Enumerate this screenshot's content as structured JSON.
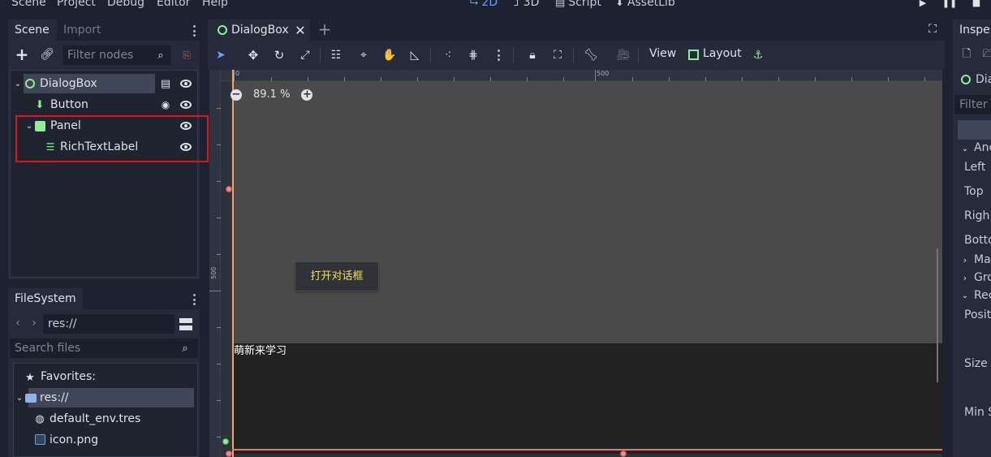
{
  "menu": {
    "items": [
      "Scene",
      "Project",
      "Debug",
      "Editor",
      "Help"
    ],
    "workspaces": [
      {
        "label": "2D",
        "icon": "2d-icon",
        "active": true
      },
      {
        "label": "3D",
        "icon": "3d-icon",
        "active": false
      },
      {
        "label": "Script",
        "icon": "script-icon",
        "active": false
      },
      {
        "label": "AssetLib",
        "icon": "assetlib-icon",
        "active": false
      }
    ]
  },
  "scene_dock": {
    "tabs": [
      "Scene",
      "Import"
    ],
    "filter_placeholder": "Filter nodes",
    "nodes": [
      {
        "label": "DialogBox",
        "icon": "control-node-icon",
        "selected": true
      },
      {
        "label": "Button",
        "icon": "button-node-icon"
      },
      {
        "label": "Panel",
        "icon": "panel-node-icon"
      },
      {
        "label": "RichTextLabel",
        "icon": "richtextlabel-node-icon"
      }
    ]
  },
  "filesystem": {
    "title": "FileSystem",
    "path": "res://",
    "search_placeholder": "Search files",
    "items": [
      "Favorites:",
      "res://",
      "default_env.tres",
      "icon.png"
    ]
  },
  "editor": {
    "tab_label": "DialogBox",
    "toolbar": {
      "view": "View",
      "layout": "Layout"
    },
    "zoom_label": "89.1 %",
    "ruler_top_labels": [
      "0",
      "500"
    ],
    "ruler_left_labels": [
      "500"
    ]
  },
  "game": {
    "button_text": "打开对话框",
    "label_text": "萌新来学习"
  },
  "inspector": {
    "tab_label": "Inspe",
    "node_label": "Dia",
    "filter_placeholder": "Filter",
    "sections": [
      "Anc",
      "Ma",
      "Gro",
      "Rec"
    ],
    "fields": [
      "Left",
      "Top",
      "Righ",
      "Botto",
      "Positi",
      "Size",
      "Min S"
    ]
  }
}
